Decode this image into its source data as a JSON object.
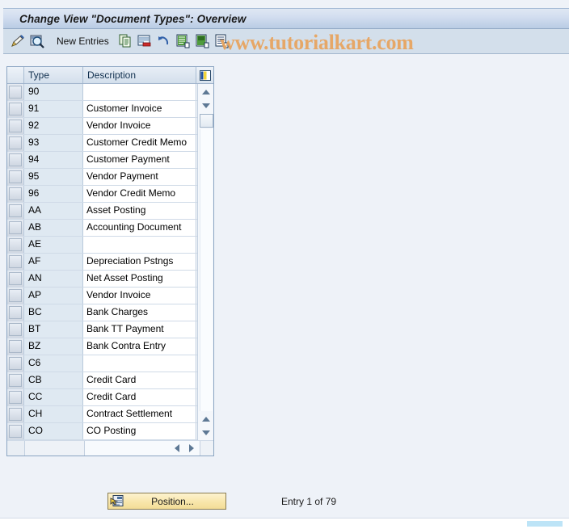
{
  "window": {
    "title": "Change View \"Document Types\": Overview"
  },
  "watermark": {
    "text": "www.tutorialkart.com",
    "color": "#e8a35c"
  },
  "toolbar": {
    "new_entries_label": "New Entries",
    "icons": [
      {
        "name": "change-display-pencil-icon",
        "tooltip": "Display/Change"
      },
      {
        "name": "display-details-magnifier-icon",
        "tooltip": "Details"
      },
      {
        "name": "copy-as-icon",
        "tooltip": "Copy As..."
      },
      {
        "name": "delete-entry-icon",
        "tooltip": "Delete"
      },
      {
        "name": "undo-change-icon",
        "tooltip": "Undo Change"
      },
      {
        "name": "select-all-variant-icon",
        "tooltip": "Select All"
      },
      {
        "name": "select-block-variant-icon",
        "tooltip": "Select Block"
      },
      {
        "name": "deselect-all-variant-icon",
        "tooltip": "Deselect All"
      }
    ]
  },
  "table": {
    "columns": [
      {
        "key": "type",
        "label": "Type"
      },
      {
        "key": "description",
        "label": "Description"
      }
    ],
    "config_icon": "column-configuration-icon",
    "rows": [
      {
        "type": "90",
        "description": ""
      },
      {
        "type": "91",
        "description": "Customer Invoice"
      },
      {
        "type": "92",
        "description": "Vendor Invoice"
      },
      {
        "type": "93",
        "description": "Customer Credit Memo"
      },
      {
        "type": "94",
        "description": "Customer Payment"
      },
      {
        "type": "95",
        "description": "Vendor Payment"
      },
      {
        "type": "96",
        "description": "Vendor Credit Memo"
      },
      {
        "type": "AA",
        "description": "Asset Posting"
      },
      {
        "type": "AB",
        "description": "Accounting Document"
      },
      {
        "type": "AE",
        "description": ""
      },
      {
        "type": "AF",
        "description": "Depreciation Pstngs"
      },
      {
        "type": "AN",
        "description": "Net Asset Posting"
      },
      {
        "type": "AP",
        "description": "Vendor Invoice"
      },
      {
        "type": "BC",
        "description": "Bank Charges"
      },
      {
        "type": "BT",
        "description": "Bank TT Payment"
      },
      {
        "type": "BZ",
        "description": "Bank Contra Entry"
      },
      {
        "type": "C6",
        "description": ""
      },
      {
        "type": "CB",
        "description": "Credit Card"
      },
      {
        "type": "CC",
        "description": "Credit Card"
      },
      {
        "type": "CH",
        "description": "Contract Settlement"
      },
      {
        "type": "CO",
        "description": "CO Posting"
      }
    ]
  },
  "scrollbars": {
    "vertical": {
      "scroll_up_icon": "scroll-up-arrow-icon",
      "scroll_down_icon": "scroll-down-arrow-icon",
      "page_up_icon": "page-up-arrow-icon",
      "page_down_icon": "page-down-arrow-icon"
    },
    "horizontal": {
      "scroll_left_icon": "scroll-left-arrow-icon",
      "scroll_right_icon": "scroll-right-arrow-icon"
    }
  },
  "footer": {
    "position_button_label": "Position...",
    "position_button_icon": "position-cursor-icon",
    "entry_status": "Entry 1 of 79"
  }
}
